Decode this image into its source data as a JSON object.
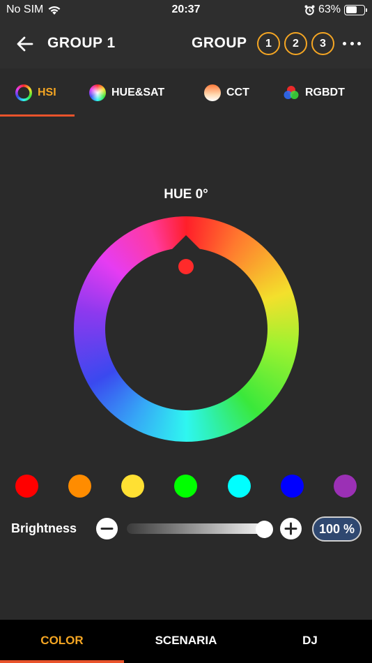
{
  "status_bar": {
    "carrier": "No SIM",
    "time": "20:37",
    "battery_percent": "63%",
    "battery_level": 0.63,
    "icons": [
      "wifi-icon",
      "alarm-icon",
      "battery-icon"
    ]
  },
  "header": {
    "title": "GROUP 1",
    "group_label": "GROUP",
    "groups": [
      "1",
      "2",
      "3"
    ],
    "accent": "#f5a623"
  },
  "tabs": [
    {
      "label": "HSI",
      "icon": "hsi-ring-icon",
      "active": true
    },
    {
      "label": "HUE&SAT",
      "icon": "hue-sat-icon",
      "active": false
    },
    {
      "label": "CCT",
      "icon": "cct-icon",
      "active": false
    },
    {
      "label": "RGBDT",
      "icon": "rgbdt-icon",
      "active": false
    }
  ],
  "hue": {
    "label": "HUE 0°",
    "value": 0,
    "selected_color": "#ff2a2a"
  },
  "presets": [
    {
      "name": "red",
      "color": "#ff0000"
    },
    {
      "name": "orange",
      "color": "#ff8c00"
    },
    {
      "name": "yellow",
      "color": "#ffe033"
    },
    {
      "name": "green",
      "color": "#00ff00"
    },
    {
      "name": "cyan",
      "color": "#00ffff"
    },
    {
      "name": "blue",
      "color": "#0000ff"
    },
    {
      "name": "purple",
      "color": "#9b30b5"
    }
  ],
  "brightness": {
    "label": "Brightness",
    "value": 100,
    "display": "100 %"
  },
  "bottom_nav": [
    {
      "label": "COLOR",
      "active": true
    },
    {
      "label": "SCENARIA",
      "active": false
    },
    {
      "label": "DJ",
      "active": false
    }
  ],
  "colors": {
    "background": "#2a2a2a",
    "accent_orange": "#f5a623",
    "underline": "#e8532b",
    "percent_button": "#2f4870"
  }
}
